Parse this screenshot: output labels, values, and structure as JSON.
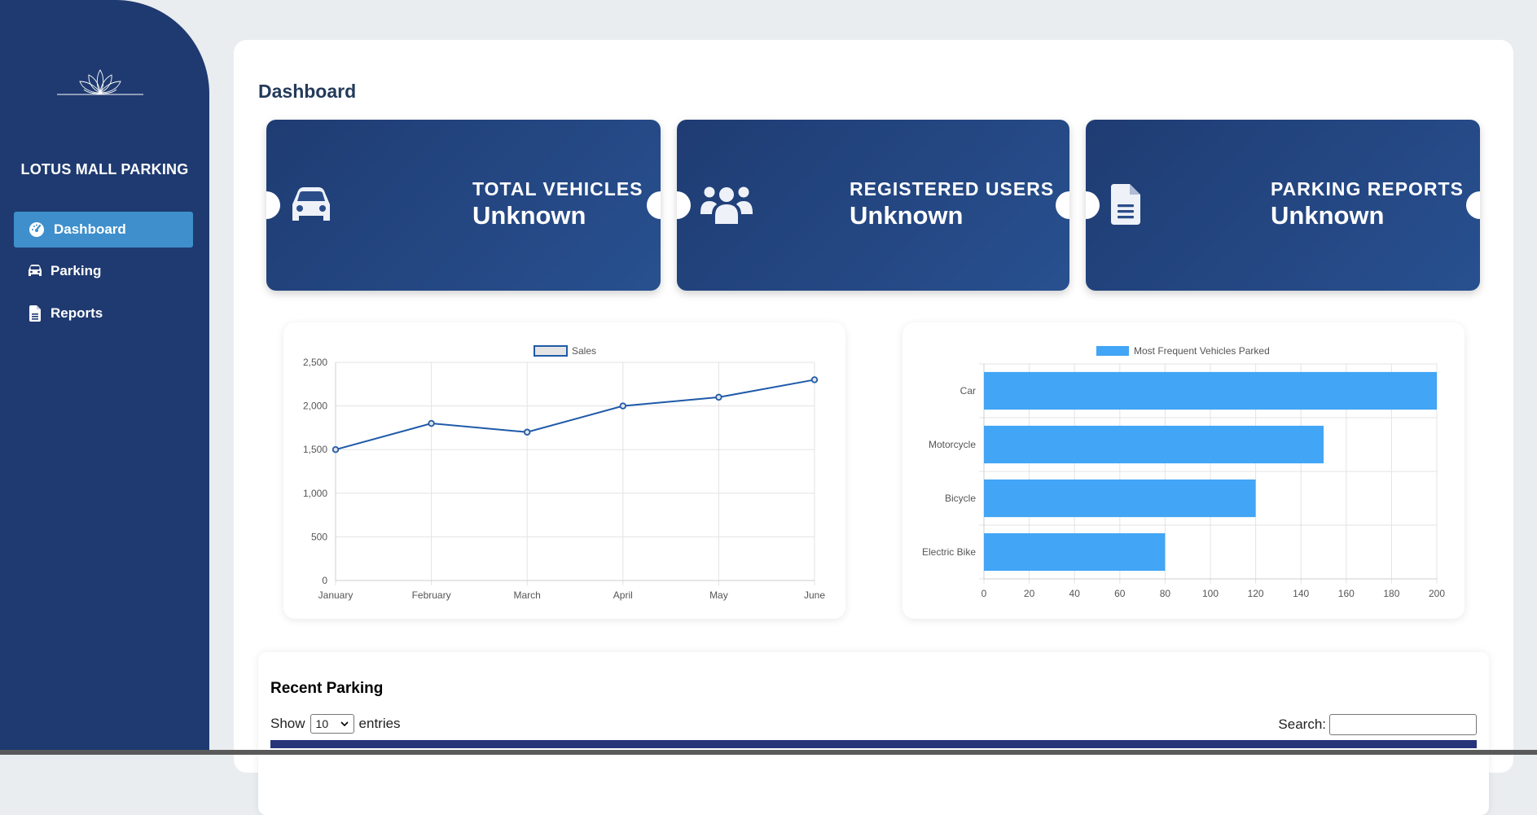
{
  "sidebar": {
    "brand": "LOTUS MALL PARKING",
    "items": [
      {
        "label": "Dashboard",
        "icon": "gauge-icon",
        "active": true
      },
      {
        "label": "Parking",
        "icon": "car-icon",
        "active": false
      },
      {
        "label": "Reports",
        "icon": "file-icon",
        "active": false
      }
    ]
  },
  "main": {
    "title": "Dashboard",
    "cards": [
      {
        "label": "TOTAL VEHICLES",
        "value": "Unknown",
        "icon": "car-icon"
      },
      {
        "label": "REGISTERED USERS",
        "value": "Unknown",
        "icon": "users-icon"
      },
      {
        "label": "PARKING REPORTS",
        "value": "Unknown",
        "icon": "file-icon"
      }
    ]
  },
  "chart_data": [
    {
      "type": "line",
      "legend": "Sales",
      "categories": [
        "January",
        "February",
        "March",
        "April",
        "May",
        "June"
      ],
      "values": [
        1500,
        1800,
        1700,
        2000,
        2100,
        2300
      ],
      "ylim": [
        0,
        2500
      ],
      "yticks": [
        "0",
        "500",
        "1,000",
        "1,500",
        "2,000",
        "2,500"
      ],
      "color": "#1f5aa8",
      "grid": true,
      "legend_position": "top"
    },
    {
      "type": "bar",
      "orientation": "horizontal",
      "legend": "Most Frequent Vehicles Parked",
      "categories": [
        "Car",
        "Motorcycle",
        "Bicycle",
        "Electric Bike"
      ],
      "values": [
        200,
        150,
        120,
        80
      ],
      "xlim": [
        0,
        200
      ],
      "xticks": [
        "0",
        "20",
        "40",
        "60",
        "80",
        "100",
        "120",
        "140",
        "160",
        "180",
        "200"
      ],
      "color": "#42a5f5",
      "grid": true,
      "legend_position": "top"
    }
  ],
  "recent": {
    "title": "Recent Parking",
    "show_label": "Show",
    "entries_value": "10",
    "entries_label": "entries",
    "search_label": "Search:"
  },
  "colors": {
    "sidebar": "#1f3a70",
    "active": "#3e8fcb",
    "card": "#24457f",
    "table_header": "#27347a"
  }
}
